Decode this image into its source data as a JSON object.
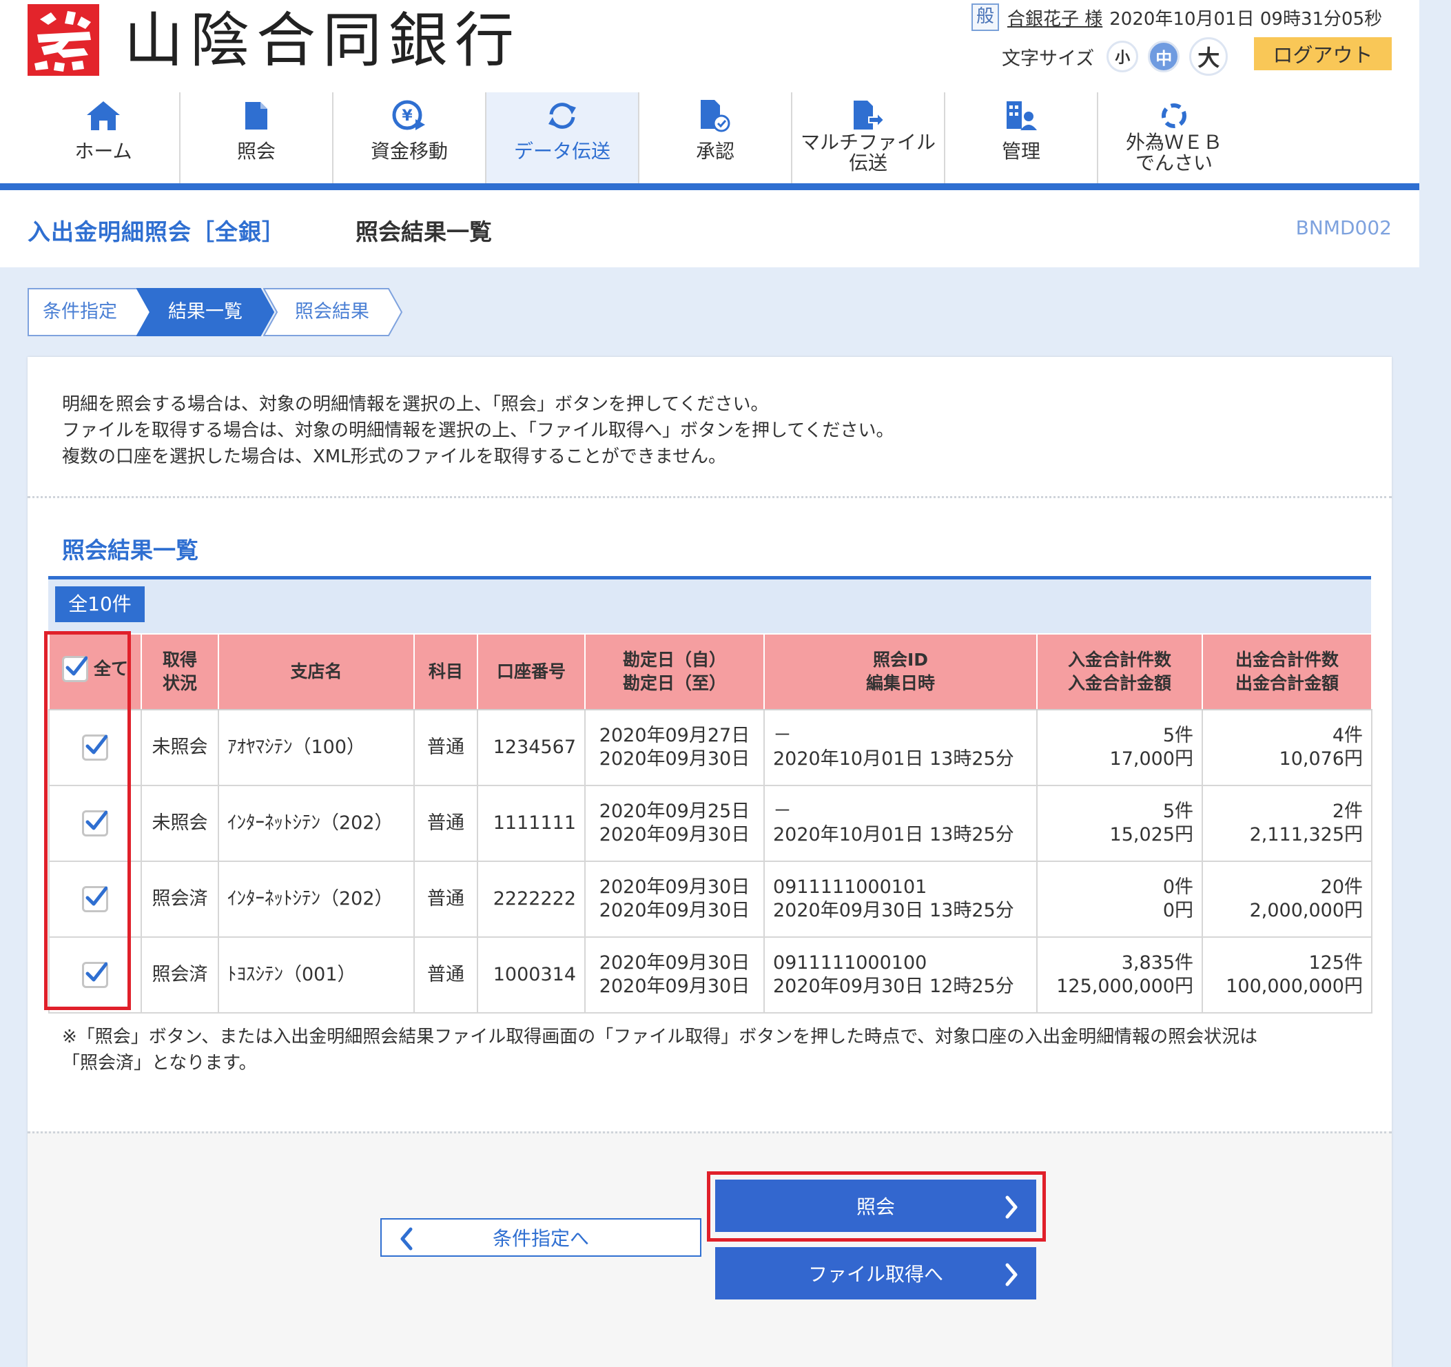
{
  "header": {
    "bank_name": "山陰合同銀行",
    "user_badge": "般",
    "user_name": "合銀花子 様",
    "datetime": "2020年10月01日 09時31分05秒",
    "font_size_label": "文字サイズ",
    "font_small": "小",
    "font_mid": "中",
    "font_large": "大",
    "logout": "ログアウト"
  },
  "nav": {
    "home": "ホーム",
    "inquiry": "照会",
    "fund_transfer": "資金移動",
    "data_transfer": "データ伝送",
    "approval": "承認",
    "multifile_1": "マルチファイル",
    "multifile_2": "伝送",
    "admin": "管理",
    "fx_web_1": "外為ＷＥＢ",
    "fx_web_2": "でんさい"
  },
  "title": {
    "main": "入出金明細照会［全銀］",
    "sub": "照会結果一覧",
    "code": "BNMD002"
  },
  "steps": [
    "条件指定",
    "結果一覧",
    "照会結果"
  ],
  "intro": [
    "明細を照会する場合は、対象の明細情報を選択の上、「照会」ボタンを押してください。",
    "ファイルを取得する場合は、対象の明細情報を選択の上、「ファイル取得へ」ボタンを押してください。",
    "複数の口座を選択した場合は、XML形式のファイルを取得することができません。"
  ],
  "section_title": "照会結果一覧",
  "count_badge": "全10件",
  "table": {
    "headers": {
      "select_all": "全て",
      "status_1": "取得",
      "status_2": "状況",
      "branch": "支店名",
      "subject": "科目",
      "account": "口座番号",
      "date_1": "勘定日（自）",
      "date_2": "勘定日（至）",
      "id_1": "照会ID",
      "id_2": "編集日時",
      "deposit_1": "入金合計件数",
      "deposit_2": "入金合計金額",
      "withdraw_1": "出金合計件数",
      "withdraw_2": "出金合計金額"
    },
    "rows": [
      {
        "checked": true,
        "status": "未照会",
        "branch": "ｱｵﾔﾏｼﾃﾝ（100）",
        "subject": "普通",
        "account": "1234567",
        "date_from": "2020年09月27日",
        "date_to": "2020年09月30日",
        "inquiry_id": "－",
        "edited": "2020年10月01日 13時25分",
        "dep_count": "5件",
        "dep_amount": "17,000円",
        "wd_count": "4件",
        "wd_amount": "10,076円"
      },
      {
        "checked": true,
        "status": "未照会",
        "branch": "ｲﾝﾀｰﾈｯﾄｼﾃﾝ（202）",
        "subject": "普通",
        "account": "1111111",
        "date_from": "2020年09月25日",
        "date_to": "2020年09月30日",
        "inquiry_id": "－",
        "edited": "2020年10月01日 13時25分",
        "dep_count": "5件",
        "dep_amount": "15,025円",
        "wd_count": "2件",
        "wd_amount": "2,111,325円"
      },
      {
        "checked": true,
        "status": "照会済",
        "branch": "ｲﾝﾀｰﾈｯﾄｼﾃﾝ（202）",
        "subject": "普通",
        "account": "2222222",
        "date_from": "2020年09月30日",
        "date_to": "2020年09月30日",
        "inquiry_id": "0911111000101",
        "edited": "2020年09月30日 13時25分",
        "dep_count": "0件",
        "dep_amount": "0円",
        "wd_count": "20件",
        "wd_amount": "2,000,000円"
      },
      {
        "checked": true,
        "status": "照会済",
        "branch": "ﾄﾖｽｼﾃﾝ（001）",
        "subject": "普通",
        "account": "1000314",
        "date_from": "2020年09月30日",
        "date_to": "2020年09月30日",
        "inquiry_id": "0911111000100",
        "edited": "2020年09月30日 12時25分",
        "dep_count": "3,835件",
        "dep_amount": "125,000,000円",
        "wd_count": "125件",
        "wd_amount": "100,000,000円"
      }
    ]
  },
  "note_1": "※「照会」ボタン、または入出金明細照会結果ファイル取得画面の「ファイル取得」ボタンを押した時点で、対象口座の入出金明細情報の照会状況は",
  "note_2": "「照会済」となります。",
  "buttons": {
    "back": "条件指定へ",
    "inquiry": "照会",
    "file": "ファイル取得へ"
  },
  "colors": {
    "brand_blue": "#2f6fd1",
    "header_pink": "#f59ea0",
    "highlight_red": "#e0202a",
    "logout_yellow": "#f9c757"
  }
}
